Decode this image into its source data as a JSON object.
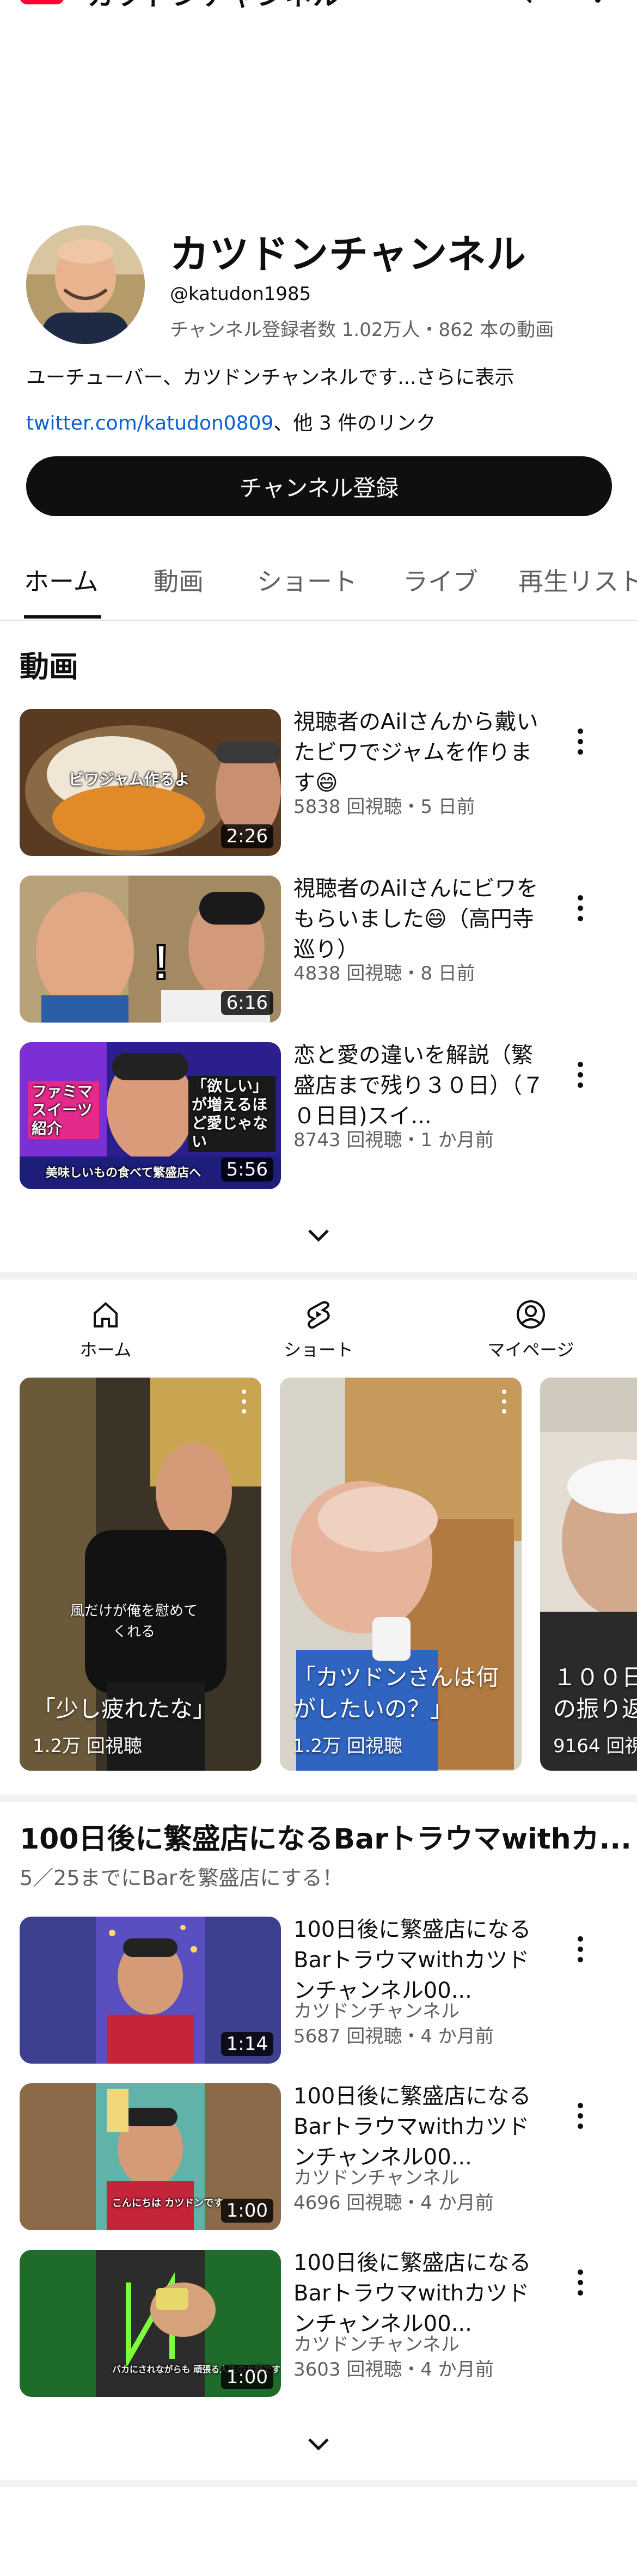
{
  "app_bar": {
    "title": "カツドンチャンネル",
    "logo_icon": "youtube-logo",
    "search_icon": "search-icon",
    "more_icon": "more-vertical-icon"
  },
  "channel": {
    "name": "カツドンチャンネル",
    "handle": "@katudon1985",
    "stats": "チャンネル登録者数 1.02万人・862 本の動画",
    "description": "ユーチューバー、カツドンチャンネルです",
    "description_more": "...さらに表示",
    "link": "twitter.com/katudon0809",
    "link_suffix": "、他 3 件のリンク",
    "subscribe_label": "チャンネル登録"
  },
  "tabs": [
    "ホーム",
    "動画",
    "ショート",
    "ライブ",
    "再生リスト"
  ],
  "videos_section": {
    "title": "動画",
    "items": [
      {
        "title": "視聴者のAilさんから戴いたビワでジャムを作ります😄",
        "meta": "5838 回視聴・5 日前",
        "duration": "2:26",
        "thumb_caption": "ビワジャム作るよ"
      },
      {
        "title": "視聴者のAilさんにビワをもらいました😄（高円寺巡り）",
        "meta": "4838 回視聴・8 日前",
        "duration": "6:16",
        "thumb_caption": ""
      },
      {
        "title": "恋と愛の違いを解説（繁盛店まで残り３０日）（７０日目)スイ...",
        "meta": "8743 回視聴・1 か月前",
        "duration": "5:56",
        "thumb_caption_1": "ファミマスイーツ紹介",
        "thumb_caption_2": "「欲しい」が増えるほど愛じゃない",
        "thumb_caption_3": "美味しいもの食べて繁盛店へ"
      }
    ]
  },
  "bottom_nav": [
    {
      "label": "ホーム",
      "icon": "home-icon"
    },
    {
      "label": "ショート",
      "icon": "shorts-icon"
    },
    {
      "label": "マイページ",
      "icon": "account-icon"
    }
  ],
  "shorts": [
    {
      "title": "「少し疲れたな」",
      "views": "1.2万 回視聴",
      "caption": "風だけが俺を慰めてくれる"
    },
    {
      "title": "「カツドンさんは何がしたいの？」",
      "views": "1.2万 回視聴"
    },
    {
      "title": "１００日の振り返",
      "views": "9164 回視"
    }
  ],
  "playlist_section": {
    "title": "100日後に繁盛店になるBarトラウマwithカ...",
    "subtitle": "5／25までにBarを繁盛店にする！",
    "items": [
      {
        "title": "100日後に繁盛店になるBarトラウマwithカツドンチャンネル00...",
        "channel": "カツドンチャンネル",
        "meta": "5687 回視聴・4 か月前",
        "duration": "1:14"
      },
      {
        "title": "100日後に繁盛店になるBarトラウマwithカツドンチャンネル00...",
        "channel": "カツドンチャンネル",
        "meta": "4696 回視聴・4 か月前",
        "duration": "1:00",
        "thumb_caption": "こんにちは カツドンです"
      },
      {
        "title": "100日後に繁盛店になるBarトラウマwithカツドンチャンネル00...",
        "channel": "カツドンチャンネル",
        "meta": "3603 回視聴・4 か月前",
        "duration": "1:00",
        "thumb_caption": "バカにされながらも 頑張る人生のお話です"
      }
    ]
  }
}
